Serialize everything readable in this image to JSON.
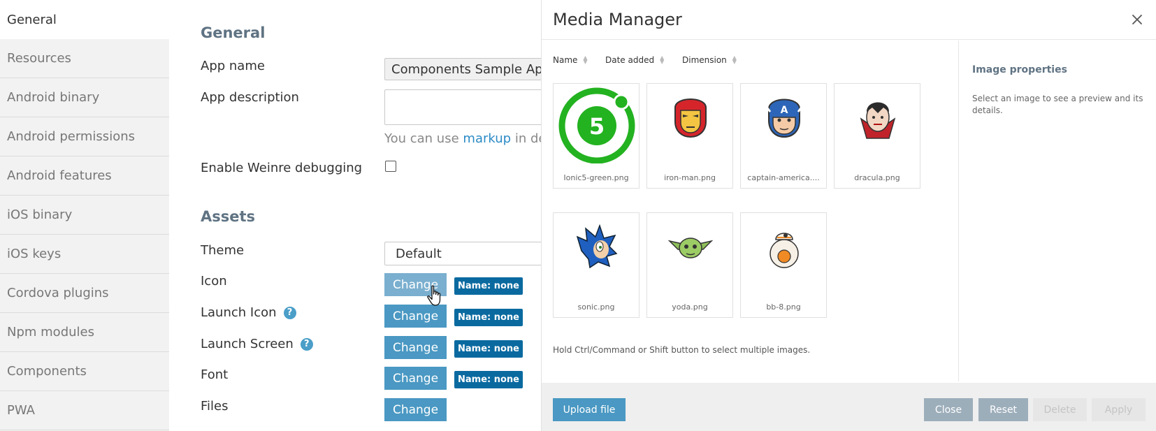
{
  "sidebar": {
    "items": [
      {
        "label": "General"
      },
      {
        "label": "Resources"
      },
      {
        "label": "Android binary"
      },
      {
        "label": "Android permissions"
      },
      {
        "label": "Android features"
      },
      {
        "label": "iOS binary"
      },
      {
        "label": "iOS keys"
      },
      {
        "label": "Cordova plugins"
      },
      {
        "label": "Npm modules"
      },
      {
        "label": "Components"
      },
      {
        "label": "PWA"
      }
    ]
  },
  "general": {
    "title": "General",
    "app_name_label": "App name",
    "app_name_value": "Components Sample App",
    "app_description_label": "App description",
    "hint_prefix": "You can use",
    "hint_link": "markup",
    "hint_suffix": "in des",
    "weinre_label": "Enable Weinre debugging"
  },
  "assets": {
    "title": "Assets",
    "theme_label": "Theme",
    "theme_value": "Default",
    "icon_label": "Icon",
    "launch_icon_label": "Launch Icon",
    "launch_screen_label": "Launch Screen",
    "font_label": "Font",
    "files_label": "Files",
    "change_label": "Change",
    "badge_label": "Name: none",
    "help_glyph": "?"
  },
  "media_manager": {
    "title": "Media Manager",
    "close_glyph": "×",
    "sort": {
      "name": "Name",
      "date": "Date added",
      "dimension": "Dimension"
    },
    "images": [
      {
        "name": "Ionic5-green.png",
        "icon": "ionic5-logo-icon"
      },
      {
        "name": "iron-man.png",
        "icon": "iron-man-icon"
      },
      {
        "name": "captain-america....",
        "icon": "captain-america-icon"
      },
      {
        "name": "dracula.png",
        "icon": "dracula-icon"
      },
      {
        "name": "sonic.png",
        "icon": "sonic-icon"
      },
      {
        "name": "yoda.png",
        "icon": "yoda-icon"
      },
      {
        "name": "bb-8.png",
        "icon": "bb8-icon"
      }
    ],
    "multi_select_hint": "Hold Ctrl/Command or Shift button to select multiple images.",
    "properties_title": "Image properties",
    "properties_text": "Select an image to see a preview and its details.",
    "buttons": {
      "upload": "Upload file",
      "close": "Close",
      "reset": "Reset",
      "delete": "Delete",
      "apply": "Apply"
    }
  },
  "colors": {
    "accent": "#4a98c3",
    "badge": "#0a6aa0",
    "section_title": "#5f7383",
    "link": "#2c8bc6"
  }
}
